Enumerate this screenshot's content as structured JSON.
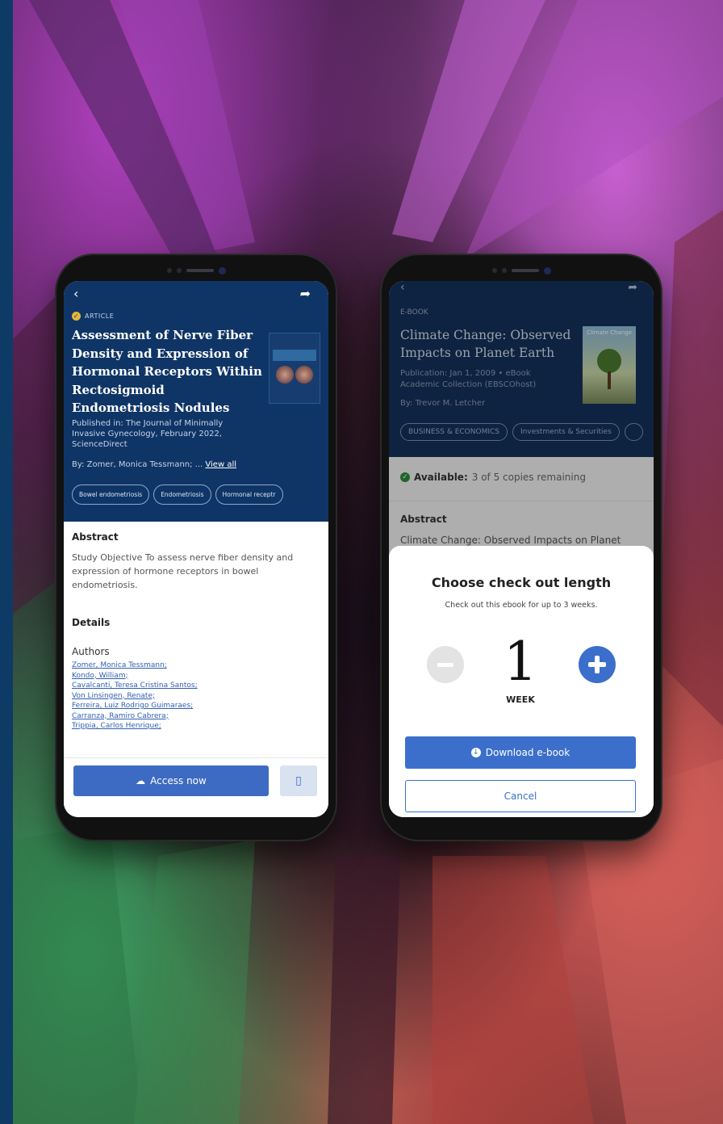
{
  "colors": {
    "brand_navy": "#0f3566",
    "accent_blue": "#3b6fcb",
    "available_green": "#2e8b3a",
    "badge_gold": "#e6b53a"
  },
  "phone1": {
    "back_icon": "chevron-left-icon",
    "share_icon": "share-icon",
    "type_label": "ARTICLE",
    "title": "Assessment of Nerve Fiber Density and Expression of Hormonal Receptors Within Rectosigmoid Endometriosis Nodules",
    "published": "Published in: The Journal of Minimally Invasive Gynecology, February 2022, ScienceDirect",
    "by": "By: Zomer, Monica Tessmann; ...",
    "view_all": "View all",
    "chips": [
      "Bowel endometriosis",
      "Endometriosis",
      "Hormonal receptr"
    ],
    "abstract_heading": "Abstract",
    "abstract_text": "Study Objective To assess nerve fiber density and expression of hormone receptors in bowel endometriosis.",
    "details_heading": "Details",
    "authors_heading": "Authors",
    "authors": [
      "Zomer, Monica Tessmann;",
      "Kondo, William;",
      "Cavalcanti, Teresa Cristina Santos;",
      "Von Linsingen, Renate;",
      "Ferreira, Luiz Rodrigo Guimaraes;",
      "Carranza, Ramiro Cabrera;",
      "Trippia, Carlos Henrique;"
    ],
    "access_button": "Access now",
    "bookmark_icon": "bookmark-icon"
  },
  "phone2": {
    "type_label": "E-BOOK",
    "title": "Climate Change: Observed Impacts on Planet Earth",
    "cover_text": "Climate Change",
    "publication": "Publication: Jan 1, 2009 • eBook",
    "collection": "Academic Collection (EBSCOhost)",
    "by": "By: Trevor M. Letcher",
    "chips": [
      "BUSINESS & ECONOMICS",
      "Investments & Securities"
    ],
    "available_label": "Available:",
    "available_text": "3 of 5 copies remaining",
    "abstract_heading": "Abstract",
    "abstract_text": "Climate Change: Observed Impacts on Planet",
    "sheet": {
      "title": "Choose check out length",
      "subtitle": "Check out this ebook for up to 3 weeks.",
      "quantity": "1",
      "unit": "WEEK",
      "download_button": "Download e-book",
      "cancel_button": "Cancel"
    }
  }
}
